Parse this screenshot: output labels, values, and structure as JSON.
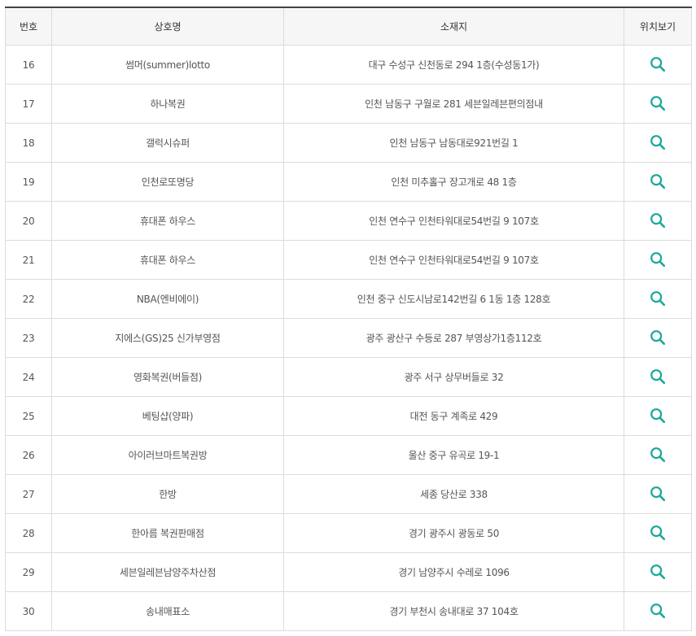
{
  "header": {
    "num": "번호",
    "name": "상호명",
    "address": "소재지",
    "location": "위치보기"
  },
  "colors": {
    "accent": "#1aa89a"
  },
  "icon": "search-icon",
  "rows": [
    {
      "num": "16",
      "name": "썸머(summer)lotto",
      "address": "대구 수성구 신천동로 294 1층(수성동1가)"
    },
    {
      "num": "17",
      "name": "하나복권",
      "address": "인천 남동구 구월로 281 세븐일레븐편의점내"
    },
    {
      "num": "18",
      "name": "갤럭시슈퍼",
      "address": "인천 남동구 남동대로921번길 1"
    },
    {
      "num": "19",
      "name": "인천로또명당",
      "address": "인천 미추홀구 장고개로 48 1층"
    },
    {
      "num": "20",
      "name": "휴대폰 하우스",
      "address": "인천 연수구 인천타워대로54번길 9 107호"
    },
    {
      "num": "21",
      "name": "휴대폰 하우스",
      "address": "인천 연수구 인천타워대로54번길 9 107호"
    },
    {
      "num": "22",
      "name": "NBA(엔비에이)",
      "address": "인천 중구 신도시남로142번길 6 1동 1층 128호"
    },
    {
      "num": "23",
      "name": "지에스(GS)25 신가부영점",
      "address": "광주 광산구 수등로 287 부영상가1층112호"
    },
    {
      "num": "24",
      "name": "영화복권(버들점)",
      "address": "광주 서구 상무버들로 32"
    },
    {
      "num": "25",
      "name": "베팅샵(양파)",
      "address": "대전 동구 계족로 429"
    },
    {
      "num": "26",
      "name": "아이러브마트복권방",
      "address": "울산 중구 유곡로 19-1"
    },
    {
      "num": "27",
      "name": "한방",
      "address": "세종 당산로 338"
    },
    {
      "num": "28",
      "name": "한아름 복권판매점",
      "address": "경기 광주시 광동로 50"
    },
    {
      "num": "29",
      "name": "세븐일레븐남양주차산점",
      "address": "경기 남양주시 수레로 1096"
    },
    {
      "num": "30",
      "name": "송내매표소",
      "address": "경기 부천시 송내대로 37 104호"
    }
  ]
}
